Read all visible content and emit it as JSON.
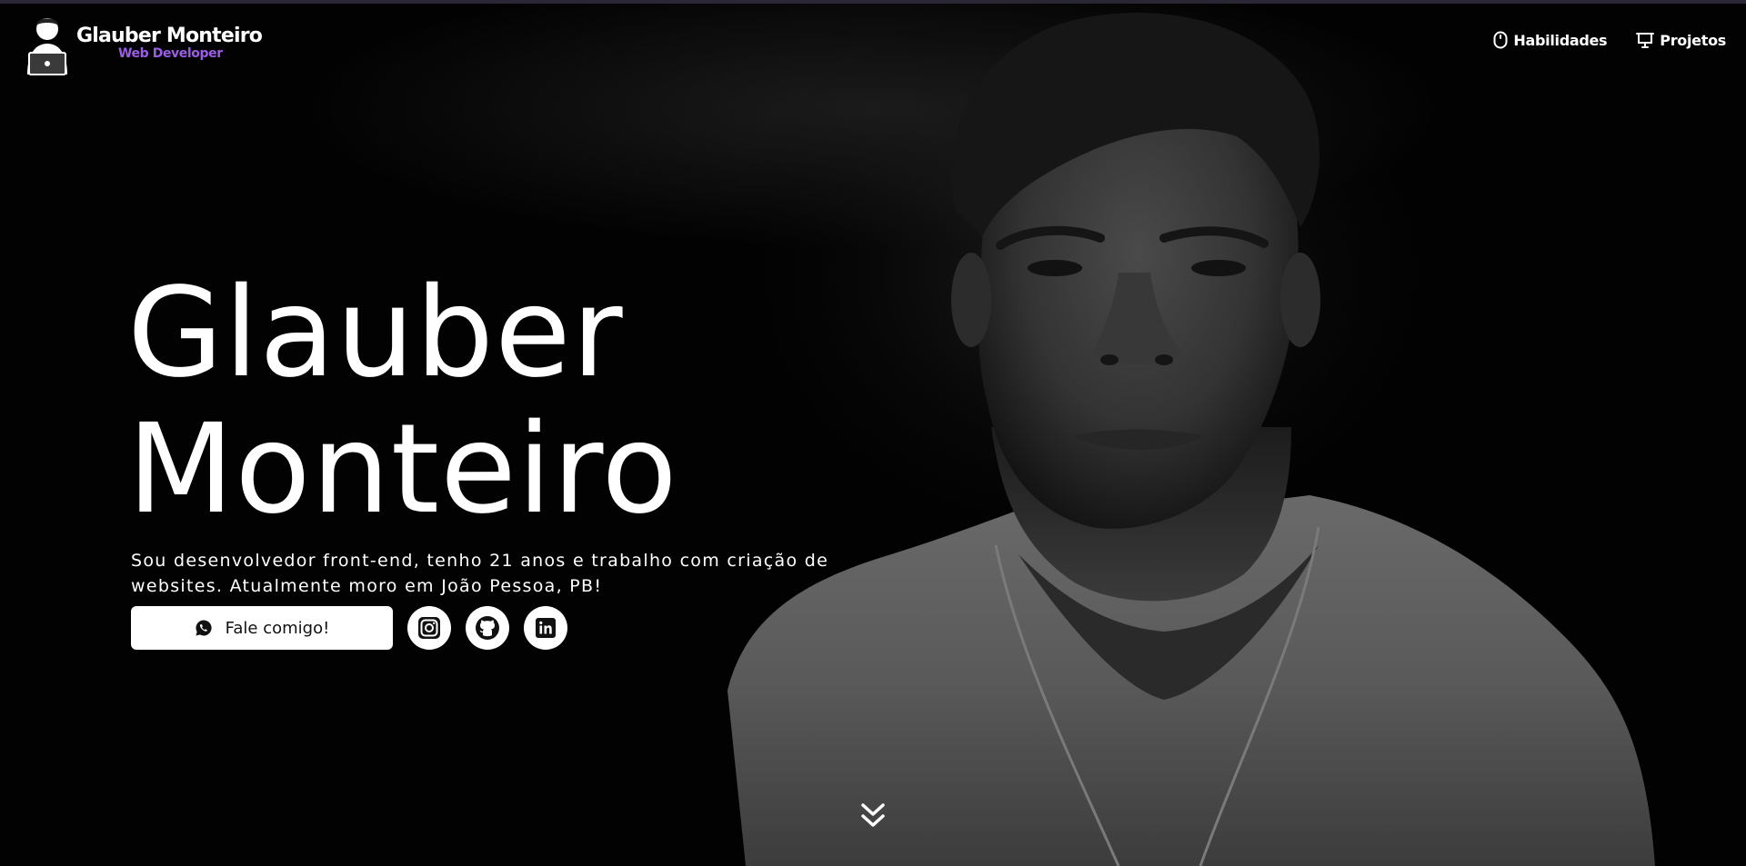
{
  "header": {
    "brand_name": "Glauber Monteiro",
    "brand_role": "Web Developer",
    "nav": [
      {
        "label": "Habilidades",
        "icon": "mouse-icon"
      },
      {
        "label": "Projetos",
        "icon": "presentation-board-icon"
      }
    ]
  },
  "hero": {
    "title_line1": "Glauber",
    "title_line2": "Monteiro",
    "description": "Sou desenvolvedor front-end, tenho 21 anos e trabalho com criação de websites. Atualmente moro em João Pessoa, PB!",
    "cta_label": "Fale comigo!",
    "cta_icon": "whatsapp-icon",
    "socials": [
      {
        "name": "instagram",
        "icon": "instagram-icon"
      },
      {
        "name": "github",
        "icon": "github-icon"
      },
      {
        "name": "linkedin",
        "icon": "linkedin-icon"
      }
    ],
    "scroll_icon": "double-chevron-down-icon"
  },
  "colors": {
    "background": "#020202",
    "accent": "#9b5de5",
    "text": "#ffffff",
    "button_bg": "#ffffff"
  }
}
